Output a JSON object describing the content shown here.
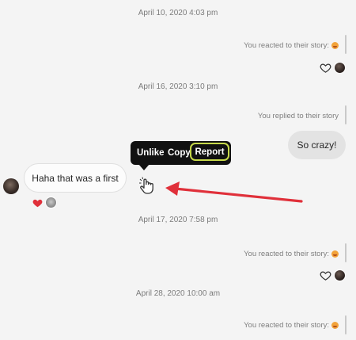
{
  "thread": {
    "ts1": "April 10, 2020 4:03 pm",
    "reacted1": "You reacted to their story:",
    "ts2": "April 16, 2020 3:10 pm",
    "replied": "You replied to their story",
    "my_message": "So crazy!",
    "their_message": "Haha that was a first",
    "ts3": "April 17, 2020 7:58 pm",
    "reacted2": "You reacted to their story:",
    "ts4": "April 28, 2020 10:00 am",
    "reacted3": "You reacted to their story:"
  },
  "context_menu": {
    "unlike": "Unlike",
    "copy": "Copy",
    "report": "Report"
  },
  "colors": {
    "highlight": "#c7d94a",
    "annotation_arrow": "#e0303a",
    "heart_red": "#e0303a"
  },
  "icons": {
    "heart_outline": "heart-outline-icon",
    "heart_filled": "heart-filled-icon",
    "pointer": "hand-pointer-icon"
  }
}
